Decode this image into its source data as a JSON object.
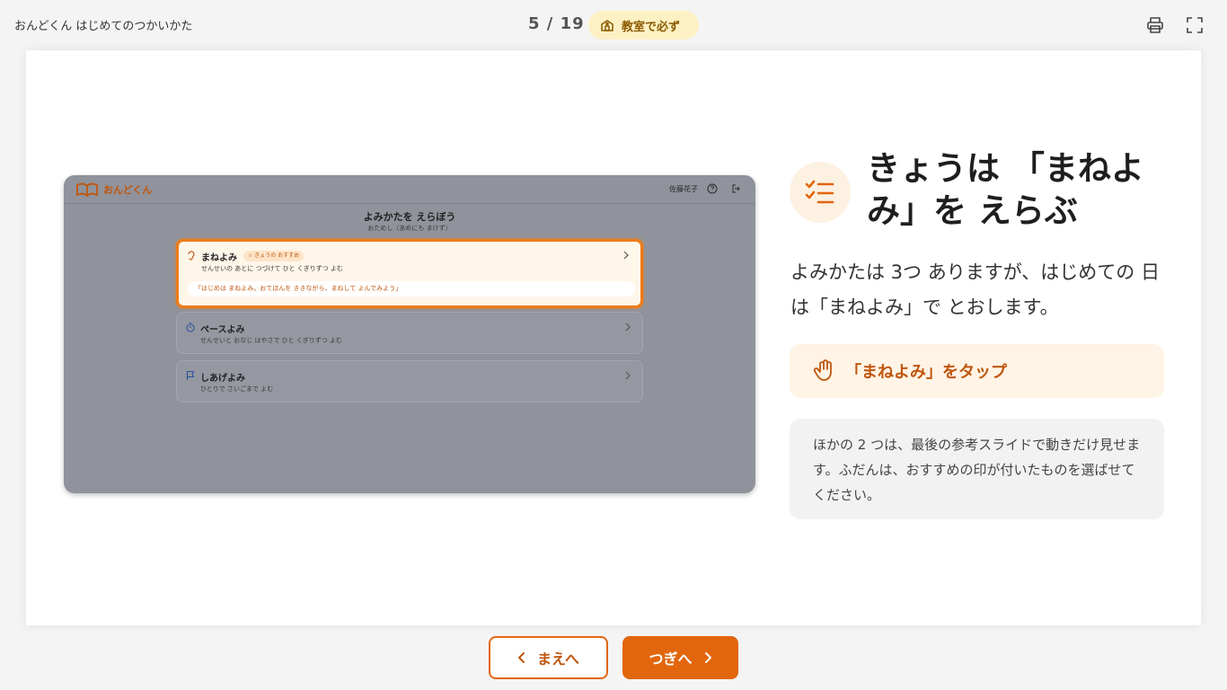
{
  "colors": {
    "accent": "#e2660e",
    "accent_dark": "#c0560e",
    "badge_bg": "#fdf1c4",
    "highlight_bg": "#fff4e5"
  },
  "header": {
    "deck_title": "おんどくん はじめてのつかいかた",
    "page_counter": "5 / 19",
    "badge_label": "教室で必ず",
    "badge_icon": "school-icon",
    "print_icon": "print-icon",
    "fullscreen_icon": "fullscreen-icon"
  },
  "mock": {
    "logo_text": "おんどくん",
    "user_name": "佐藤花子",
    "title": "よみかたを えらぼう",
    "subtitle": "おためし（あめにも まけず）",
    "cards": [
      {
        "title": "まねよみ",
        "tag": "☆ きょうの おすすめ",
        "desc": "せんせいの あとに つづけて ひと くぎりずつ よむ",
        "quote": "「はじめは まねよみ。おてほんを ききながら、まねして よんでみよう」",
        "icon": "ear-icon"
      },
      {
        "title": "ペースよみ",
        "desc": "せんせいと おなじ はやさで ひと くぎりずつ よむ",
        "icon": "stopwatch-icon"
      },
      {
        "title": "しあげよみ",
        "desc": "ひとりで さいごまで よむ",
        "icon": "flag-icon"
      }
    ]
  },
  "content": {
    "heading": "きょうは 「まねよみ」を えらぶ",
    "lead": "よみかたは 3つ ありますが、はじめての 日は「まねよみ」で とおします。",
    "tap_instruction": "「まねよみ」をタップ",
    "note": "ほかの 2 つは、最後の参考スライドで動きだけ見せます。ふだんは、おすすめの印が付いたものを選ばせてください。"
  },
  "nav": {
    "prev_label": "まえへ",
    "next_label": "つぎへ"
  }
}
